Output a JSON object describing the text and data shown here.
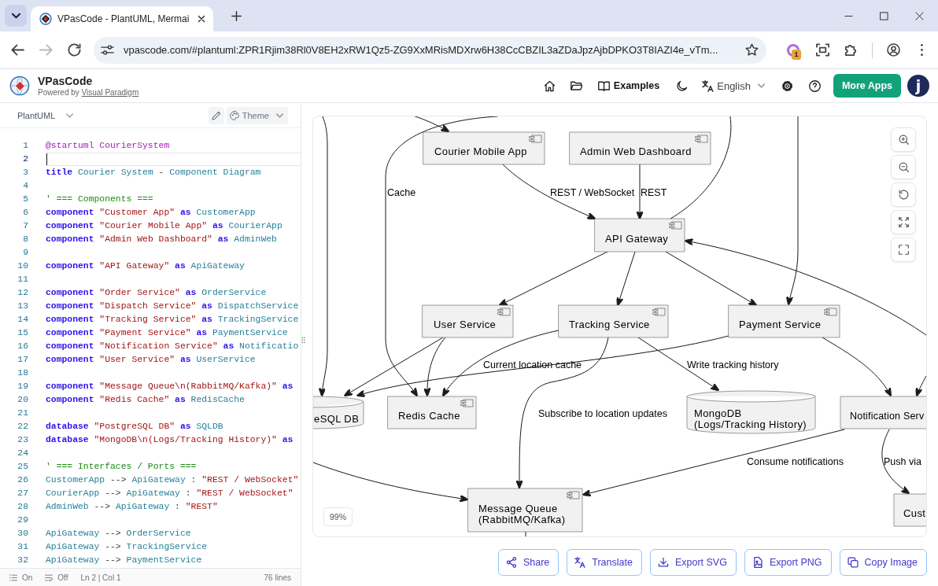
{
  "browser": {
    "tabs": [
      {
        "title": "VPasCode - PlantUML, Mermai",
        "selected": true
      }
    ],
    "url": "vpascode.com/#plantuml:ZPR1Rjim38Rl0V8EH2xRW1Qz5-ZG9XxMRisMDXrw6H38CcCBZIL3aZDaJpzAjbDPKO3T8IAZI4e_vTm...",
    "extension_badge": "1"
  },
  "header": {
    "brand": "VPasCode",
    "tagline": "Powered by",
    "tagline_link": "Visual Paradigm",
    "examples": "Examples",
    "language": "English",
    "more_apps": "More Apps",
    "avatar": "j"
  },
  "editor": {
    "language": "PlantUML",
    "theme": "Theme",
    "lines": [
      {
        "number": "1",
        "active": false,
        "tokens": [
          {
            "kind": "directive",
            "text": "@startuml CourierSystem"
          }
        ]
      },
      {
        "number": "2",
        "active": true
      },
      {
        "number": "3",
        "active": false,
        "tokens": [
          {
            "kind": "keyword",
            "text": "title"
          },
          {
            "kind": "ident",
            "text": " Courier System"
          },
          {
            "kind": "op",
            "text": " - "
          },
          {
            "kind": "ident",
            "text": "Component Diagram"
          }
        ]
      },
      {
        "number": "4",
        "active": false
      },
      {
        "number": "5",
        "active": false,
        "tokens": [
          {
            "kind": "comment",
            "text": "' === Components ==="
          }
        ]
      },
      {
        "number": "6",
        "active": false,
        "tokens": [
          {
            "kind": "keyword",
            "text": "component"
          },
          {
            "kind": "string",
            "text": " \"Customer App\""
          },
          {
            "kind": "keyword",
            "text": " as"
          },
          {
            "kind": "ident",
            "text": " CustomerApp"
          }
        ]
      },
      {
        "number": "7",
        "active": false,
        "tokens": [
          {
            "kind": "keyword",
            "text": "component"
          },
          {
            "kind": "string",
            "text": " \"Courier Mobile App\""
          },
          {
            "kind": "keyword",
            "text": " as"
          },
          {
            "kind": "ident",
            "text": " CourierApp"
          }
        ]
      },
      {
        "number": "8",
        "active": false,
        "tokens": [
          {
            "kind": "keyword",
            "text": "component"
          },
          {
            "kind": "string",
            "text": " \"Admin Web Dashboard\""
          },
          {
            "kind": "keyword",
            "text": " as"
          },
          {
            "kind": "ident",
            "text": " AdminWeb"
          }
        ]
      },
      {
        "number": "9",
        "active": false
      },
      {
        "number": "10",
        "active": false,
        "tokens": [
          {
            "kind": "keyword",
            "text": "component"
          },
          {
            "kind": "string",
            "text": " \"API Gateway\""
          },
          {
            "kind": "keyword",
            "text": " as"
          },
          {
            "kind": "ident",
            "text": " ApiGateway"
          }
        ]
      },
      {
        "number": "11",
        "active": false
      },
      {
        "number": "12",
        "active": false,
        "tokens": [
          {
            "kind": "keyword",
            "text": "component"
          },
          {
            "kind": "string",
            "text": " \"Order Service\""
          },
          {
            "kind": "keyword",
            "text": " as"
          },
          {
            "kind": "ident",
            "text": " OrderService"
          }
        ]
      },
      {
        "number": "13",
        "active": false,
        "tokens": [
          {
            "kind": "keyword",
            "text": "component"
          },
          {
            "kind": "string",
            "text": " \"Dispatch Service\""
          },
          {
            "kind": "keyword",
            "text": " as"
          },
          {
            "kind": "ident",
            "text": " DispatchService"
          }
        ]
      },
      {
        "number": "14",
        "active": false,
        "tokens": [
          {
            "kind": "keyword",
            "text": "component"
          },
          {
            "kind": "string",
            "text": " \"Tracking Service\""
          },
          {
            "kind": "keyword",
            "text": " as"
          },
          {
            "kind": "ident",
            "text": " TrackingService"
          }
        ]
      },
      {
        "number": "15",
        "active": false,
        "tokens": [
          {
            "kind": "keyword",
            "text": "component"
          },
          {
            "kind": "string",
            "text": " \"Payment Service\""
          },
          {
            "kind": "keyword",
            "text": " as"
          },
          {
            "kind": "ident",
            "text": " PaymentService"
          }
        ]
      },
      {
        "number": "16",
        "active": false,
        "tokens": [
          {
            "kind": "keyword",
            "text": "component"
          },
          {
            "kind": "string",
            "text": " \"Notification Service\""
          },
          {
            "kind": "keyword",
            "text": " as"
          },
          {
            "kind": "ident",
            "text": " Notificatio"
          }
        ]
      },
      {
        "number": "17",
        "active": false,
        "tokens": [
          {
            "kind": "keyword",
            "text": "component"
          },
          {
            "kind": "string",
            "text": " \"User Service\""
          },
          {
            "kind": "keyword",
            "text": " as"
          },
          {
            "kind": "ident",
            "text": " UserService"
          }
        ]
      },
      {
        "number": "18",
        "active": false
      },
      {
        "number": "19",
        "active": false,
        "tokens": [
          {
            "kind": "keyword",
            "text": "component"
          },
          {
            "kind": "string",
            "text": " \"Message Queue\\n(RabbitMQ/Kafka)\""
          },
          {
            "kind": "keyword",
            "text": " as"
          }
        ]
      },
      {
        "number": "20",
        "active": false,
        "tokens": [
          {
            "kind": "keyword",
            "text": "component"
          },
          {
            "kind": "string",
            "text": " \"Redis Cache\""
          },
          {
            "kind": "keyword",
            "text": " as"
          },
          {
            "kind": "ident",
            "text": " RedisCache"
          }
        ]
      },
      {
        "number": "21",
        "active": false
      },
      {
        "number": "22",
        "active": false,
        "tokens": [
          {
            "kind": "keyword",
            "text": "database"
          },
          {
            "kind": "string",
            "text": " \"PostgreSQL DB\""
          },
          {
            "kind": "keyword",
            "text": " as"
          },
          {
            "kind": "ident",
            "text": " SQLDB"
          }
        ]
      },
      {
        "number": "23",
        "active": false,
        "tokens": [
          {
            "kind": "keyword",
            "text": "database"
          },
          {
            "kind": "string",
            "text": " \"MongoDB\\n(Logs/Tracking History)\""
          },
          {
            "kind": "keyword",
            "text": " as"
          }
        ]
      },
      {
        "number": "24",
        "active": false
      },
      {
        "number": "25",
        "active": false,
        "tokens": [
          {
            "kind": "comment",
            "text": "' === Interfaces / Ports ==="
          }
        ]
      },
      {
        "number": "26",
        "active": false,
        "tokens": [
          {
            "kind": "ident",
            "text": "CustomerApp"
          },
          {
            "kind": "op",
            "text": " --> "
          },
          {
            "kind": "ident",
            "text": "ApiGateway"
          },
          {
            "kind": "op",
            "text": " : "
          },
          {
            "kind": "string",
            "text": "\"REST / WebSocket\""
          }
        ]
      },
      {
        "number": "27",
        "active": false,
        "tokens": [
          {
            "kind": "ident",
            "text": "CourierApp"
          },
          {
            "kind": "op",
            "text": " --> "
          },
          {
            "kind": "ident",
            "text": "ApiGateway"
          },
          {
            "kind": "op",
            "text": " : "
          },
          {
            "kind": "string",
            "text": "\"REST / WebSocket\""
          }
        ]
      },
      {
        "number": "28",
        "active": false,
        "tokens": [
          {
            "kind": "ident",
            "text": "AdminWeb"
          },
          {
            "kind": "op",
            "text": " --> "
          },
          {
            "kind": "ident",
            "text": "ApiGateway"
          },
          {
            "kind": "op",
            "text": " : "
          },
          {
            "kind": "string",
            "text": "\"REST\""
          }
        ]
      },
      {
        "number": "29",
        "active": false
      },
      {
        "number": "30",
        "active": false,
        "tokens": [
          {
            "kind": "ident",
            "text": "ApiGateway"
          },
          {
            "kind": "op",
            "text": " --> "
          },
          {
            "kind": "ident",
            "text": "OrderService"
          }
        ]
      },
      {
        "number": "31",
        "active": false,
        "tokens": [
          {
            "kind": "ident",
            "text": "ApiGateway"
          },
          {
            "kind": "op",
            "text": " --> "
          },
          {
            "kind": "ident",
            "text": "TrackingService"
          }
        ]
      },
      {
        "number": "32",
        "active": false,
        "tokens": [
          {
            "kind": "ident",
            "text": "ApiGateway"
          },
          {
            "kind": "op",
            "text": " --> "
          },
          {
            "kind": "ident",
            "text": "PaymentService"
          }
        ]
      }
    ],
    "status": {
      "line_numbers": "On",
      "word_wrap": "Off",
      "cursor": "Ln 2 | Col 1",
      "line_count": "76 lines"
    }
  },
  "diagram": {
    "nodes": [
      {
        "kind": "component",
        "lines": [
          "Courier Mobile App"
        ]
      },
      {
        "kind": "component",
        "lines": [
          "Admin Web Dashboard"
        ]
      },
      {
        "kind": "component",
        "lines": [
          "API Gateway"
        ]
      },
      {
        "kind": "component",
        "lines": [
          "User Service"
        ]
      },
      {
        "kind": "component",
        "lines": [
          "Tracking Service"
        ]
      },
      {
        "kind": "component",
        "lines": [
          "Payment Service"
        ]
      },
      {
        "kind": "database",
        "lines": [
          "eSQL DB"
        ]
      },
      {
        "kind": "component",
        "lines": [
          "Redis Cache"
        ]
      },
      {
        "kind": "database",
        "lines": [
          "MongoDB",
          "(Logs/Tracking History)"
        ]
      },
      {
        "kind": "component",
        "lines": [
          "Notification Serv"
        ]
      },
      {
        "kind": "component",
        "lines": [
          "Message Queue",
          "(RabbitMQ/Kafka)"
        ]
      },
      {
        "kind": "component",
        "lines": [
          "Cust"
        ]
      }
    ],
    "edge_labels": [
      "Cache",
      "REST / WebSocket",
      "REST",
      "Current location cache",
      "Write tracking history",
      "Subscribe to location updates",
      "Consume notifications",
      "Push via"
    ],
    "zoom_level": "99%"
  },
  "actions": [
    {
      "kind": "share",
      "label": "Share"
    },
    {
      "kind": "translate",
      "label": "Translate"
    },
    {
      "kind": "export-svg",
      "label": "Export SVG"
    },
    {
      "kind": "export-png",
      "label": "Export PNG"
    },
    {
      "kind": "copy-image",
      "label": "Copy Image"
    }
  ]
}
